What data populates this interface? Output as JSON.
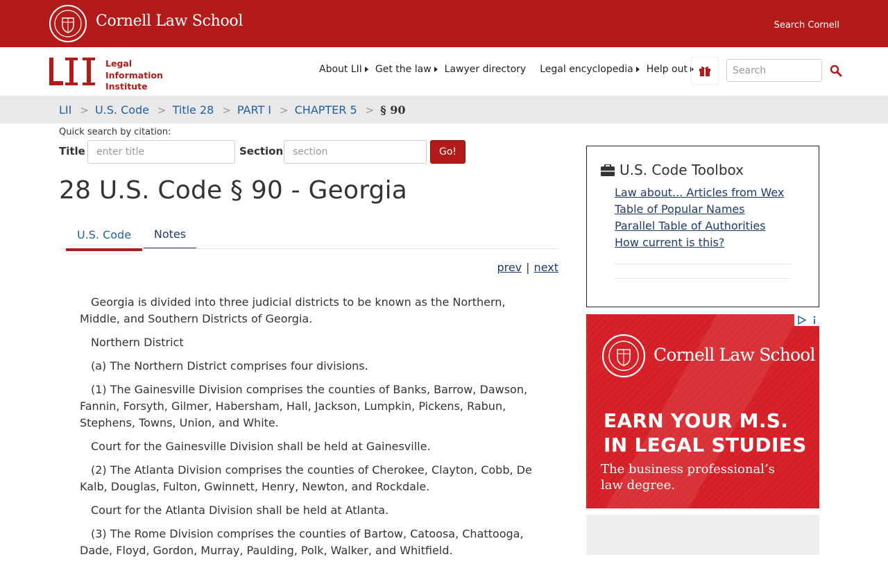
{
  "header": {
    "brand": "Cornell Law School",
    "search_cornell": "Search Cornell"
  },
  "lii": {
    "mark": "LII",
    "line1": "Legal",
    "line2": "Information",
    "line3": "Institute"
  },
  "nav": {
    "items": [
      {
        "label": "About LII",
        "caret": true
      },
      {
        "label": "Get the law",
        "caret": true
      },
      {
        "label": "Lawyer directory",
        "caret": false
      },
      {
        "label": "Legal encyclopedia",
        "caret": true
      },
      {
        "label": "Help out",
        "caret": true
      }
    ],
    "search_placeholder": "Search"
  },
  "breadcrumb": {
    "items": [
      "LII",
      "U.S. Code",
      "Title 28",
      "PART I",
      "CHAPTER 5"
    ],
    "separator": ">",
    "current": "§ 90"
  },
  "quick_search": {
    "label": "Quick search by citation:",
    "title_label": "Title",
    "title_placeholder": "enter title",
    "section_label": "Section",
    "section_placeholder": "section",
    "go_label": "Go!"
  },
  "page": {
    "title": "28 U.S. Code § 90 - Georgia",
    "tabs": [
      "U.S. Code",
      "Notes"
    ],
    "prev": "prev",
    "sep": "|",
    "next": "next"
  },
  "statute": {
    "paragraphs": [
      "Georgia is divided into three judicial districts to be known as the Northern, Middle, and Southern Districts of Georgia.",
      "Northern District",
      "(a) The Northern District comprises four divisions.",
      "(1) The Gainesville Division comprises the counties of Banks, Barrow, Dawson, Fannin, Forsyth, Gilmer, Habersham, Hall, Jackson, Lumpkin, Pickens, Rabun, Stephens, Towns, Union, and White.",
      "Court for the Gainesville Division shall be held at Gainesville.",
      "(2) The Atlanta Division comprises the counties of Cherokee, Clayton, Cobb, De Kalb, Douglas, Fulton, Gwinnett, Henry, Newton, and Rockdale.",
      "Court for the Atlanta Division shall be held at Atlanta.",
      "(3) The Rome Division comprises the counties of Bartow, Catoosa, Chattooga, Dade, Floyd, Gordon, Murray, Paulding, Polk, Walker, and Whitfield."
    ]
  },
  "toolbox": {
    "title": "U.S. Code Toolbox",
    "links": [
      "Law about... Articles from Wex",
      "Table of Popular Names",
      "Parallel Table of Authorities",
      "How current is this?"
    ]
  },
  "ad": {
    "brand": "Cornell Law School",
    "headline1": "EARN YOUR M.S.",
    "headline2": "IN LEGAL STUDIES",
    "sub1": "The business professional’s",
    "sub2": "law degree."
  },
  "colors": {
    "brand_red": "#b31b1b",
    "link_blue": "#1f5f9e",
    "ad_red": "#d8232a"
  },
  "icons": {
    "search": "magnifier-icon",
    "gift": "gift-icon",
    "toolbox": "briefcase-icon"
  }
}
